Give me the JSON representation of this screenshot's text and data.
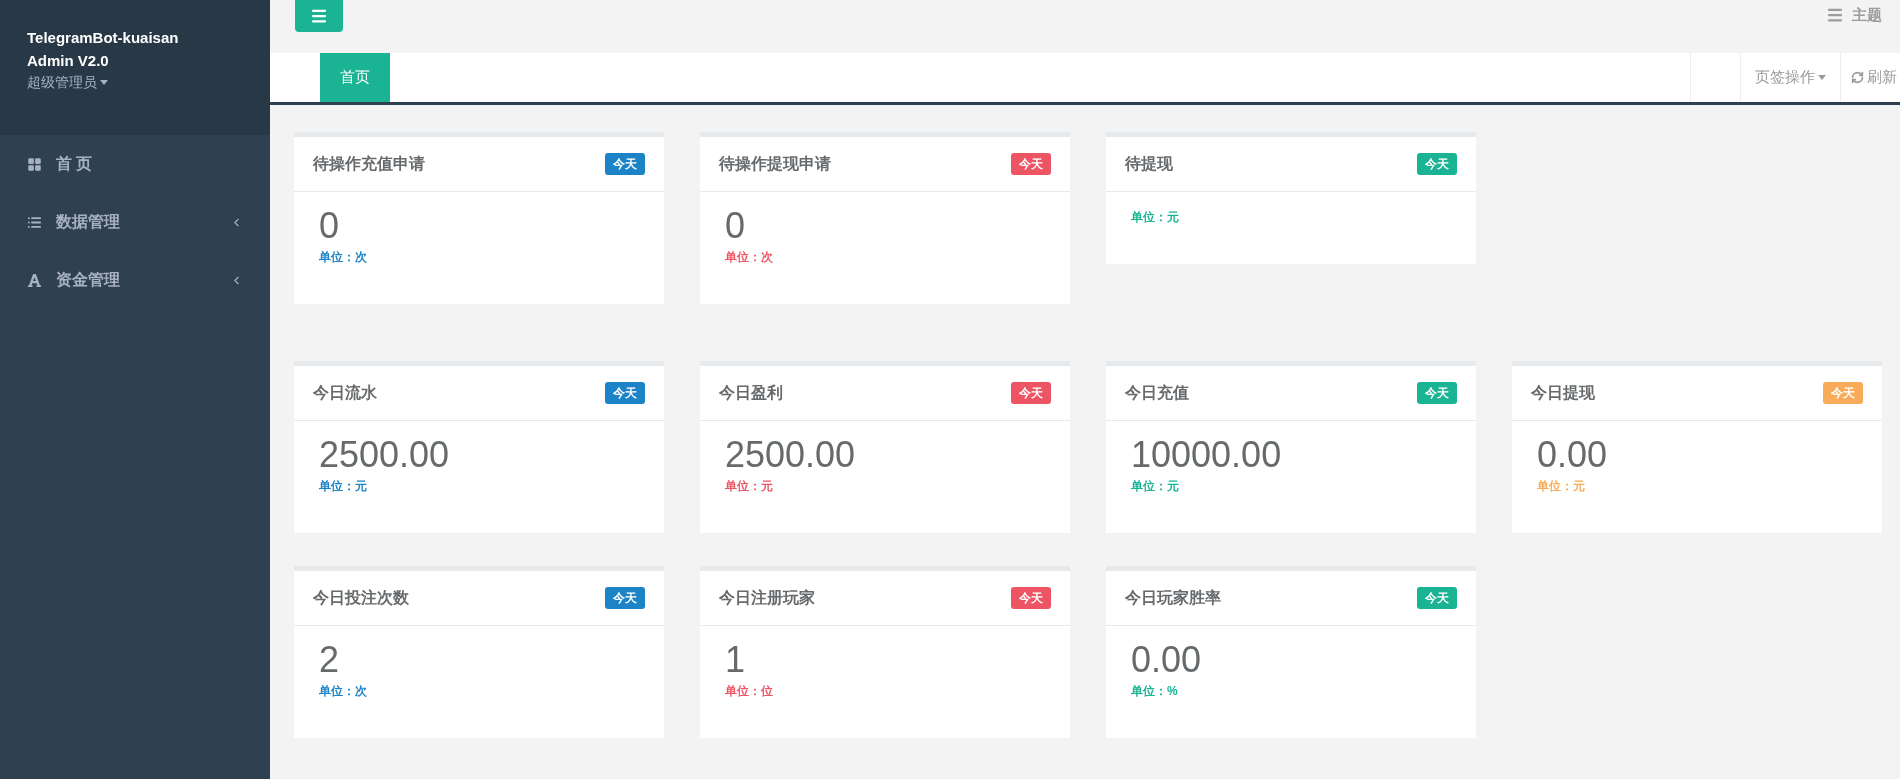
{
  "sidebar": {
    "title_lines": [
      "TelegramBot-kuaisan",
      "Admin V2.0"
    ],
    "role": "超级管理员",
    "items": [
      {
        "label": "首 页",
        "kind": "grid",
        "has_submenu": false
      },
      {
        "label": "数据管理",
        "kind": "list",
        "has_submenu": true
      },
      {
        "label": "资金管理",
        "kind": "font",
        "has_submenu": true
      }
    ]
  },
  "topbar": {
    "theme_label": "主题"
  },
  "tabs": [
    {
      "label": "首页",
      "selected": true
    }
  ],
  "tab_actions": {
    "menu": "页签操作",
    "refresh": "刷新"
  },
  "sections": [
    {
      "cards": [
        {
          "title": "待操作充值申请",
          "badge": "今天",
          "color": "#1c84c6",
          "value": "0",
          "unit": "单位：次"
        },
        {
          "title": "待操作提现申请",
          "badge": "今天",
          "color": "#ed5565",
          "value": "0",
          "unit": "单位：次"
        },
        {
          "title": "待提现",
          "badge": "今天",
          "color": "#1ab394",
          "unit": "单位：元"
        }
      ]
    },
    {
      "cards": [
        {
          "title": "今日流水",
          "badge": "今天",
          "color": "#1c84c6",
          "value": "2500.00",
          "unit": "单位：元"
        },
        {
          "title": "今日盈利",
          "badge": "今天",
          "color": "#ed5565",
          "value": "2500.00",
          "unit": "单位：元"
        },
        {
          "title": "今日充值",
          "badge": "今天",
          "color": "#1ab394",
          "value": "10000.00",
          "unit": "单位：元"
        },
        {
          "title": "今日提现",
          "badge": "今天",
          "color": "#f8ac59",
          "value": "0.00",
          "unit": "单位：元"
        },
        {
          "title": "今日投注次数",
          "badge": "今天",
          "color": "#1c84c6",
          "value": "2",
          "unit": "单位：次"
        },
        {
          "title": "今日注册玩家",
          "badge": "今天",
          "color": "#ed5565",
          "value": "1",
          "unit": "单位：位"
        },
        {
          "title": "今日玩家胜率",
          "badge": "今天",
          "color": "#1ab394",
          "value": "0.00",
          "unit": "单位：%"
        }
      ]
    }
  ]
}
